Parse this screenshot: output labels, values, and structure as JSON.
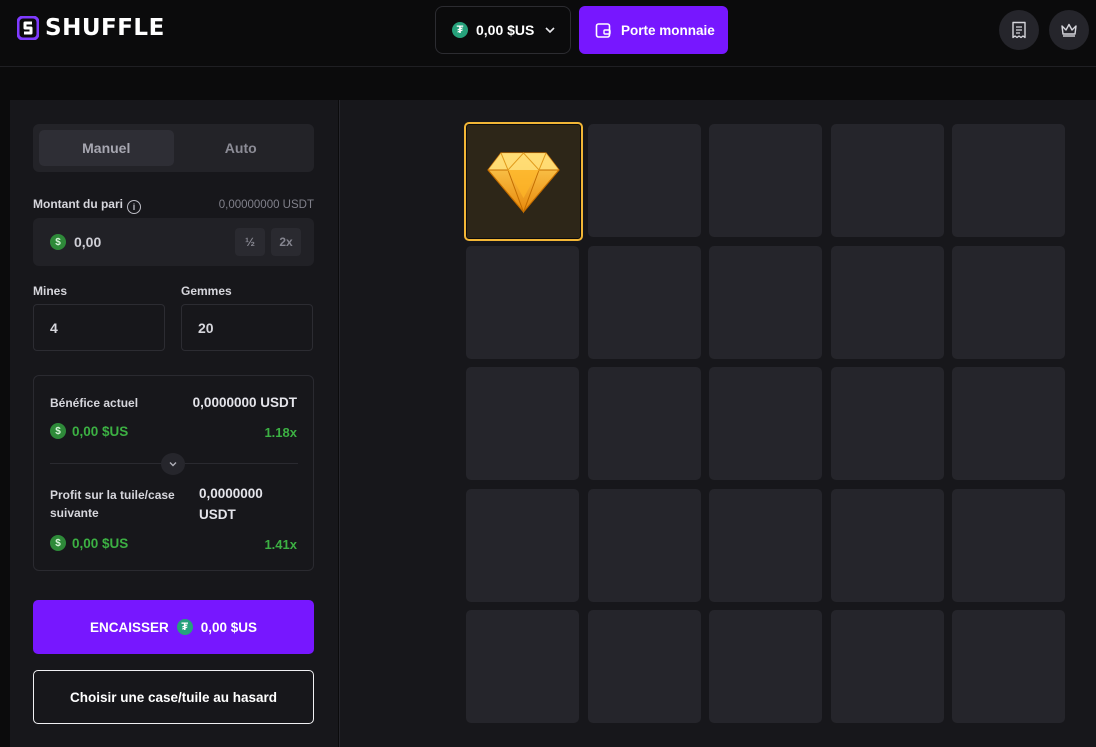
{
  "header": {
    "logo_text": "SHUFFLE",
    "balance": "0,00 $US",
    "wallet_label": "Porte monnaie",
    "icons": [
      "logo-icon",
      "tether-icon",
      "chevron-down-icon",
      "wallet-icon",
      "receipt-icon",
      "crown-icon"
    ]
  },
  "panel": {
    "tabs": [
      {
        "label": "Manuel",
        "active": true
      },
      {
        "label": "Auto",
        "active": false
      }
    ],
    "bet_label": "Montant du pari",
    "bet_usdt": "0,00000000 USDT",
    "bet_value": "0,00",
    "half_label": "½",
    "double_label": "2x",
    "mines_label": "Mines",
    "mines_value": "4",
    "gems_label": "Gemmes",
    "gems_value": "20",
    "current_profit_label": "Bénéfice actuel",
    "current_profit_usdt": "0,0000000 USDT",
    "current_profit_usd": "0,00 $US",
    "current_multiplier": "1.18x",
    "next_profit_label_line1": "Profit sur la tuile/case",
    "next_profit_label_line2": "suivante",
    "next_profit_usdt_line1": "0,0000000",
    "next_profit_usdt_line2": "USDT",
    "next_profit_usd": "0,00 $US",
    "next_multiplier": "1.41x",
    "cashout_label": "ENCAISSER",
    "cashout_amount": "0,00 $US",
    "random_label": "Choisir une case/tuile au hasard"
  },
  "grid": {
    "rows": 5,
    "cols": 5,
    "revealed_gems": [
      0
    ]
  },
  "colors": {
    "accent": "#7717ff",
    "green": "#3cb043",
    "gem": "#f2b636",
    "tile": "#25252b"
  }
}
